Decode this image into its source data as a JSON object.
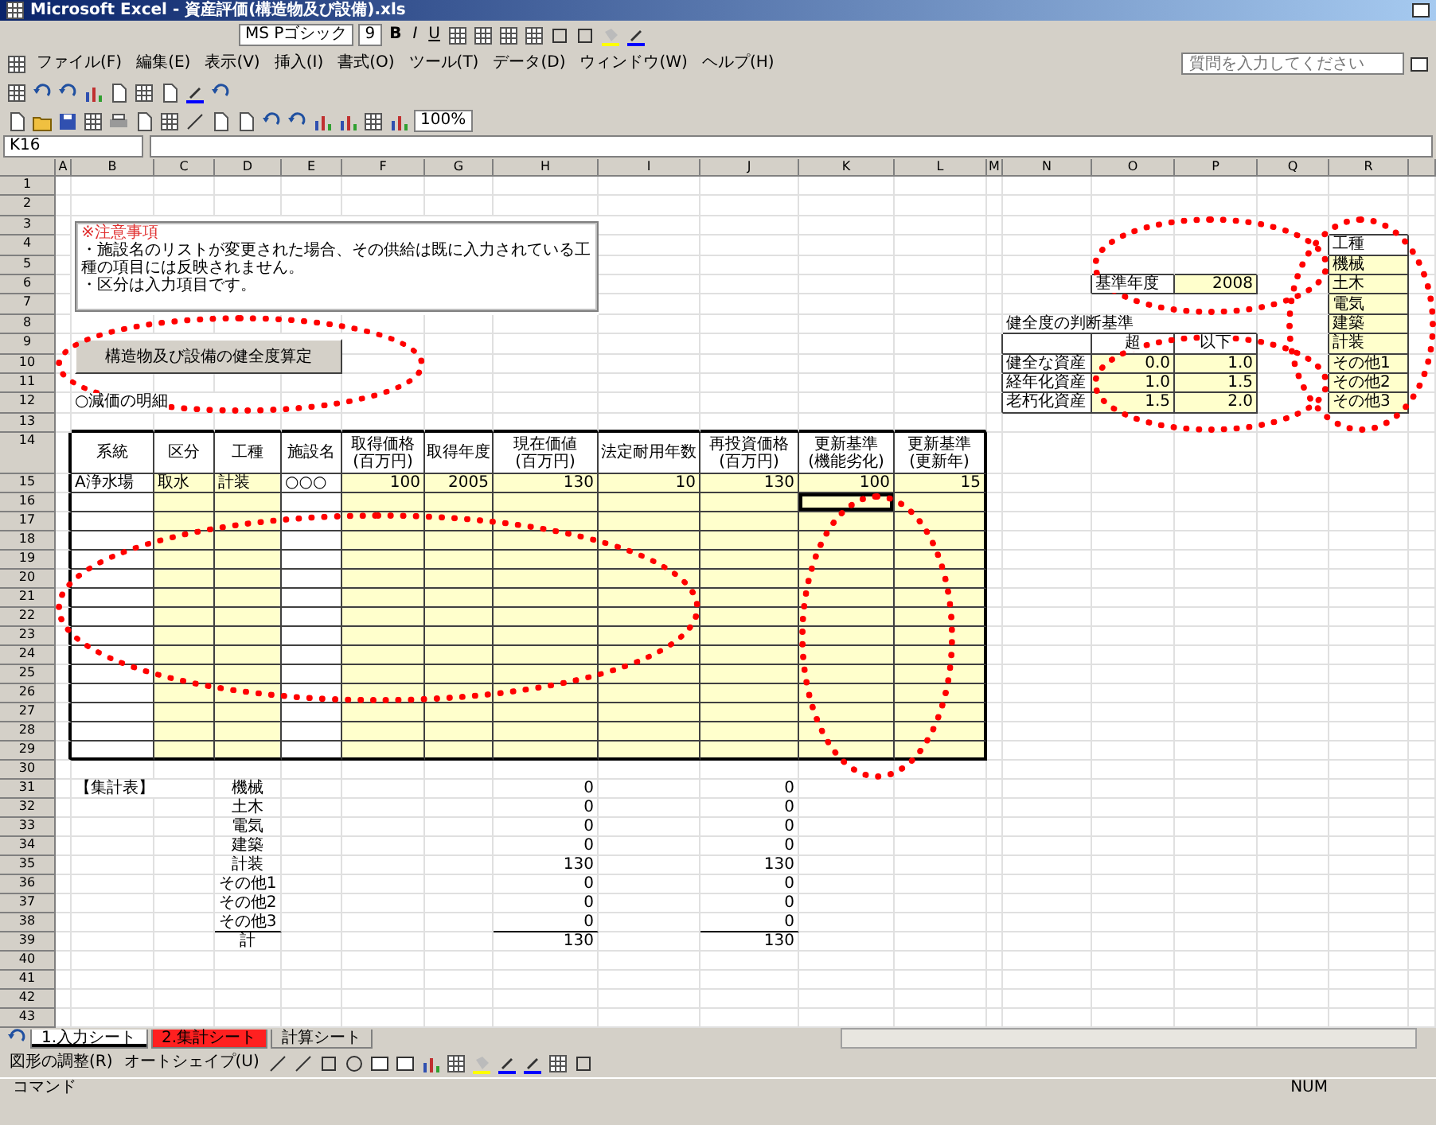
{
  "window": {
    "title": "Microsoft Excel - 資産評価(構造物及び設備).xls"
  },
  "format_toolbar": {
    "font": "MS Pゴシック",
    "size": "9",
    "style_buttons": [
      "B",
      "I",
      "U"
    ]
  },
  "menu": [
    "ファイル(F)",
    "編集(E)",
    "表示(V)",
    "挿入(I)",
    "書式(O)",
    "ツール(T)",
    "データ(D)",
    "ウィンドウ(W)",
    "ヘルプ(H)"
  ],
  "help_box": {
    "placeholder": "質問を入力してください"
  },
  "standard_toolbar": {
    "zoom": "100%"
  },
  "formula_bar": {
    "name_box": "K16"
  },
  "sheet": {
    "column_headers": [
      "A",
      "B",
      "C",
      "D",
      "E",
      "F",
      "G",
      "H",
      "I",
      "J",
      "K",
      "L",
      "M",
      "N",
      "O",
      "P",
      "Q",
      "R"
    ],
    "row_headers": [
      "1",
      "2",
      "3",
      "4",
      "5",
      "6",
      "7",
      "8",
      "9",
      "10",
      "11",
      "12",
      "13",
      "14",
      "15",
      "16",
      "17",
      "18",
      "19",
      "20",
      "21",
      "22",
      "23",
      "24",
      "25",
      "26",
      "27",
      "28",
      "29",
      "30",
      "31",
      "32",
      "33",
      "34",
      "35",
      "36",
      "37",
      "38",
      "39",
      "40",
      "41",
      "42",
      "43"
    ],
    "note": {
      "title": "※注意事項",
      "lines": [
        "・施設名のリストが変更された場合、その供給は既に入力されている工種の項目には反映されません。",
        "・区分は入力項目です。"
      ]
    },
    "button": {
      "label": "構造物及び設備の健全度算定"
    },
    "option_label": "○減価の明細",
    "main_table": {
      "columns": [
        {
          "label": "系統",
          "kind": "text",
          "input": false
        },
        {
          "label": "区分",
          "kind": "text",
          "input": true
        },
        {
          "label": "工種",
          "kind": "text",
          "input": true
        },
        {
          "label": "施設名",
          "kind": "text",
          "input": false
        },
        {
          "label": "取得価格\n(百万円)",
          "kind": "number",
          "input": true
        },
        {
          "label": "取得年度",
          "kind": "number",
          "input": true
        },
        {
          "label": "現在価値\n(百万円)",
          "kind": "number",
          "input": true
        },
        {
          "label": "法定耐用年数",
          "kind": "number",
          "input": true
        },
        {
          "label": "再投資価格\n(百万円)",
          "kind": "number",
          "input": true
        },
        {
          "label": "更新基準\n(機能劣化)",
          "kind": "number",
          "input": true
        },
        {
          "label": "更新基準\n(更新年)",
          "kind": "number",
          "input": true
        }
      ],
      "rows": [
        [
          "A浄水場",
          "取水",
          "計装",
          "○○○",
          "100",
          "2005",
          "130",
          "10",
          "130",
          "100",
          "15"
        ]
      ]
    },
    "summary": {
      "title": "【集計表】",
      "rows": [
        {
          "label": "機械",
          "current": "0",
          "reinvest": "0"
        },
        {
          "label": "土木",
          "current": "0",
          "reinvest": "0"
        },
        {
          "label": "電気",
          "current": "0",
          "reinvest": "0"
        },
        {
          "label": "建築",
          "current": "0",
          "reinvest": "0"
        },
        {
          "label": "計装",
          "current": "130",
          "reinvest": "130"
        },
        {
          "label": "その他1",
          "current": "0",
          "reinvest": "0"
        },
        {
          "label": "その他2",
          "current": "0",
          "reinvest": "0"
        },
        {
          "label": "その他3",
          "current": "0",
          "reinvest": "0"
        }
      ],
      "total": {
        "label": "計",
        "current": "130",
        "reinvest": "130"
      }
    },
    "base_year": {
      "label": "基準年度",
      "value": "2008",
      "input": true
    },
    "criteria": {
      "title": "健全度の判断基準",
      "columns": [
        "超",
        "以下"
      ],
      "input": true,
      "rows": [
        {
          "label": "健全な資産",
          "values": [
            "0.0",
            "1.0"
          ]
        },
        {
          "label": "経年化資産",
          "values": [
            "1.0",
            "1.5"
          ]
        },
        {
          "label": "老朽化資産",
          "values": [
            "1.5",
            "2.0"
          ]
        }
      ]
    },
    "work_types": {
      "header": "工種",
      "input": true,
      "items": [
        "機械",
        "土木",
        "電気",
        "建築",
        "計装",
        "その他1",
        "その他2",
        "その他3"
      ]
    },
    "annotations": [
      {
        "kind": "ellipse"
      },
      {
        "kind": "ellipse"
      },
      {
        "kind": "ellipse"
      },
      {
        "kind": "ellipse"
      },
      {
        "kind": "ellipse"
      },
      {
        "kind": "ellipse"
      }
    ]
  },
  "sheet_tabs": [
    {
      "label": "1.入力シート",
      "selected": true
    },
    {
      "label": "2.集計シート",
      "selected": false,
      "color": "#ff2020"
    },
    {
      "label": "計算シート",
      "selected": false
    }
  ],
  "drawing_toolbar": {
    "draw_menu": "図形の調整(R)",
    "autoshape_menu": "オートシェイプ(U)"
  },
  "status_bar": {
    "mode": "コマンド",
    "indicator": "NUM"
  }
}
